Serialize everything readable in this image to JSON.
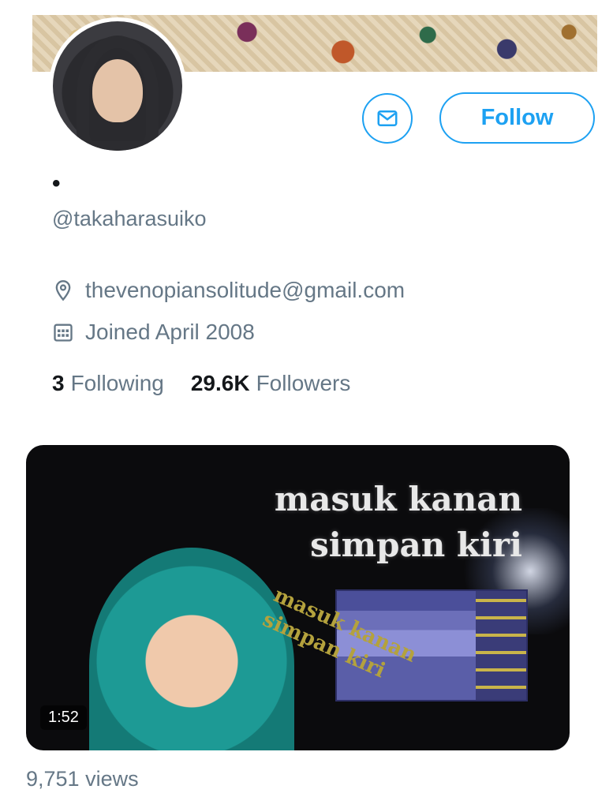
{
  "profile": {
    "display_name": "•",
    "handle": "@takaharasuiko",
    "location": "thevenopiansolitude@gmail.com",
    "joined": "Joined April 2008"
  },
  "actions": {
    "follow_label": "Follow"
  },
  "stats": {
    "following_count": "3",
    "following_label": "Following",
    "followers_count": "29.6K",
    "followers_label": "Followers"
  },
  "media": {
    "overlay_line1": "masuk kanan",
    "overlay_line2": "simpan kiri",
    "slant_line1": "masuk kanan",
    "slant_line2": "simpan kiri",
    "duration": "1:52",
    "views": "9,751 views"
  },
  "colors": {
    "accent": "#1da1f2",
    "secondary_text": "#657786",
    "primary_text": "#14171a"
  },
  "icons": [
    "mail-icon",
    "location-pin-icon",
    "calendar-icon"
  ]
}
